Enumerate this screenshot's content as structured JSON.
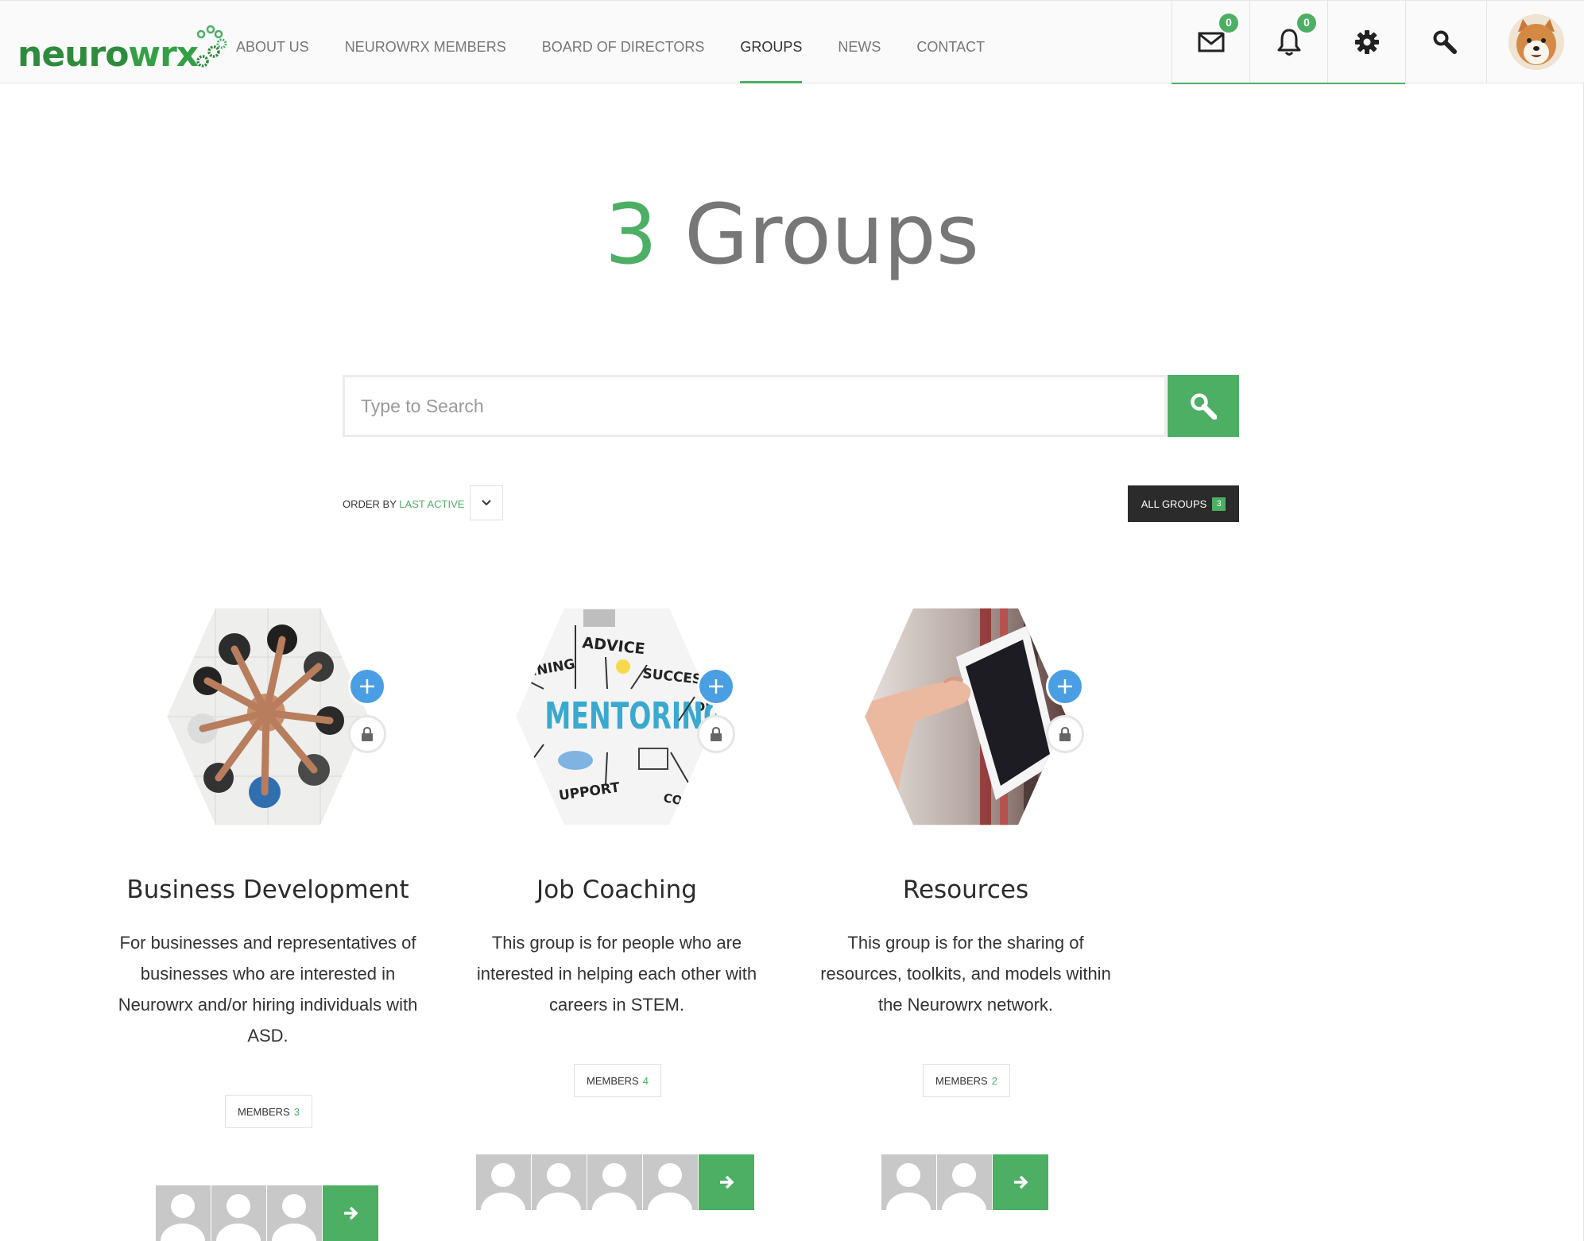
{
  "brand": {
    "name_part1": "neuro",
    "name_part2": "wrx",
    "accent": "#4caf63"
  },
  "nav": {
    "items": [
      {
        "label": "ABOUT US"
      },
      {
        "label": "NEUROWRX MEMBERS"
      },
      {
        "label": "BOARD OF DIRECTORS"
      },
      {
        "label": "GROUPS"
      },
      {
        "label": "NEWS"
      },
      {
        "label": "CONTACT"
      }
    ],
    "active": "GROUPS"
  },
  "header_icons": {
    "messages": {
      "icon": "envelope-icon",
      "count": "0"
    },
    "notifications": {
      "icon": "bell-icon",
      "count": "0"
    },
    "settings": {
      "icon": "gear-icon"
    },
    "search": {
      "icon": "search-icon"
    },
    "profile": {
      "icon": "avatar"
    }
  },
  "page": {
    "count": "3",
    "title": "Groups"
  },
  "search": {
    "placeholder": "Type to Search"
  },
  "order": {
    "label": "ORDER BY",
    "value": "LAST ACTIVE"
  },
  "filter": {
    "label": "ALL GROUPS",
    "count": "3"
  },
  "groups": [
    {
      "title": "Business Development",
      "description": "For businesses and representatives of businesses who are interested in Neurowrx and/or hiring individuals with ASD.",
      "members_label": "MEMBERS",
      "members_count": "3",
      "avatar_count": 3
    },
    {
      "title": "Job Coaching",
      "description": "This group is for people who are interested in helping each other with careers in STEM.",
      "members_label": "MEMBERS",
      "members_count": "4",
      "avatar_count": 4
    },
    {
      "title": "Resources",
      "description": "This group is for the sharing of resources, toolkits, and models within the Neurowrx network.",
      "members_label": "MEMBERS",
      "members_count": "2",
      "avatar_count": 2
    }
  ],
  "mentoring_image_words": [
    "ADVICE",
    "RAINING",
    "SUCCES",
    "MENTORING",
    "DI",
    "UPPORT",
    "CO"
  ]
}
